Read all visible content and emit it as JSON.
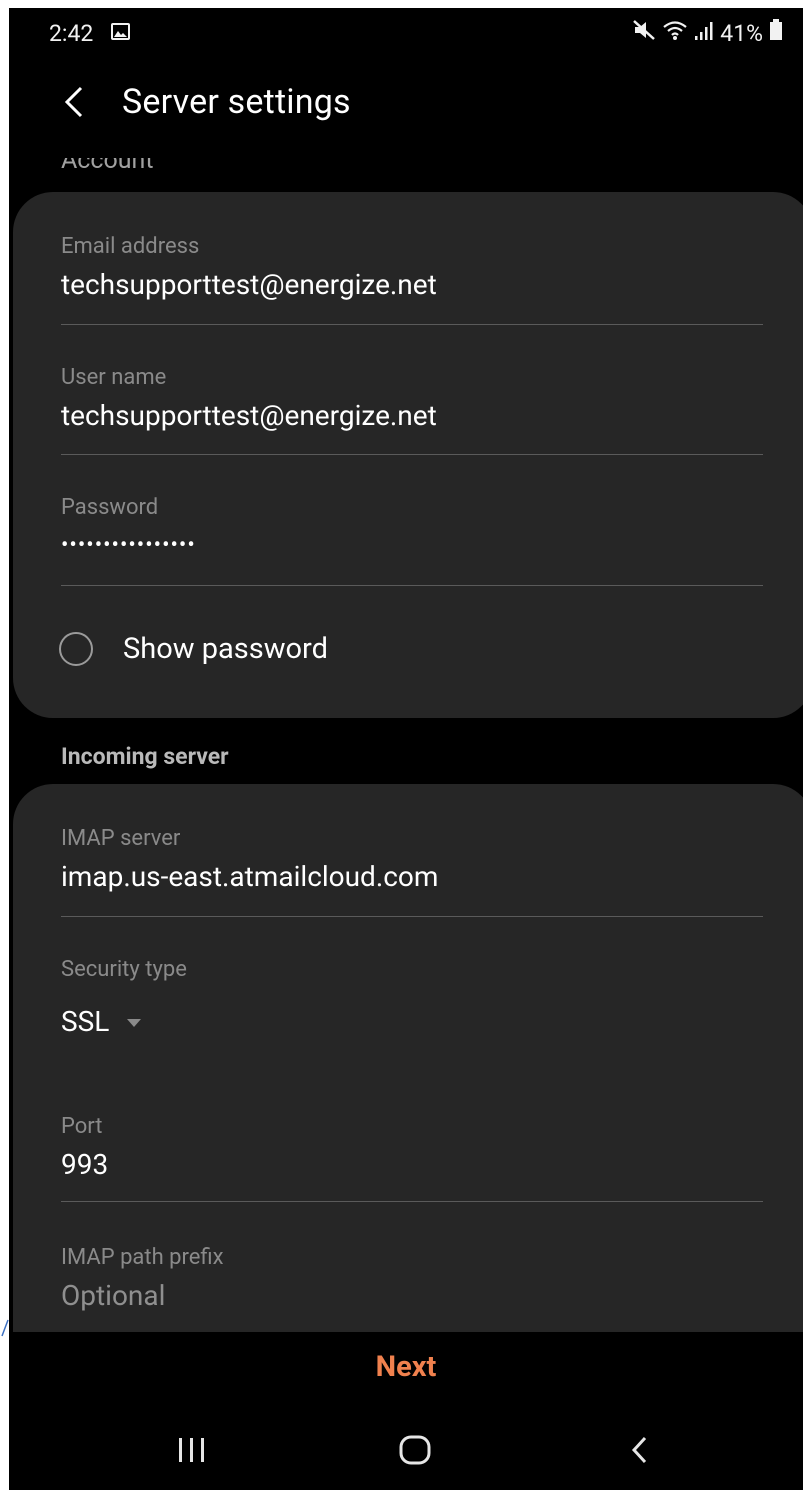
{
  "status_bar": {
    "time": "2:42",
    "battery": "41%"
  },
  "header": {
    "title": "Server settings"
  },
  "account": {
    "section_label": "Account",
    "email_label": "Email address",
    "email_value": "techsupporttest@energize.net",
    "username_label": "User name",
    "username_value": "techsupporttest@energize.net",
    "password_label": "Password",
    "password_value": "••••••••••••••••",
    "show_password_label": "Show password",
    "show_password_checked": false
  },
  "incoming": {
    "section_label": "Incoming server",
    "imap_server_label": "IMAP server",
    "imap_server_value": "imap.us-east.atmailcloud.com",
    "security_type_label": "Security type",
    "security_type_value": "SSL",
    "port_label": "Port",
    "port_value": "993",
    "path_prefix_label": "IMAP path prefix",
    "path_prefix_placeholder": "Optional"
  },
  "footer": {
    "next_label": "Next"
  },
  "icons": {
    "status": [
      "image-icon",
      "mute-icon",
      "wifi-icon",
      "signal-icon",
      "battery-icon"
    ],
    "nav": [
      "recents-icon",
      "home-icon",
      "back-icon"
    ]
  },
  "colors": {
    "accent": "#f0814e",
    "card_background": "#262626",
    "screen_background": "#000000"
  }
}
